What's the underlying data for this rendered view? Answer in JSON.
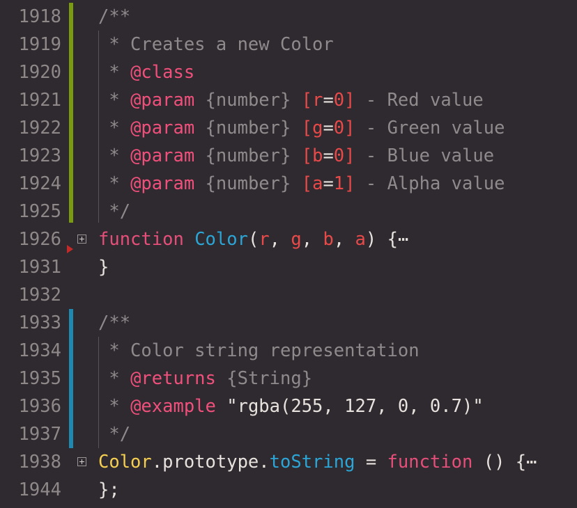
{
  "editor": {
    "colors": {
      "background": "#2f2a2f",
      "modified_bar_1": "#7a9a10",
      "modified_bar_2": "#1e88b0",
      "keyword": "#e54f7a",
      "function": "#2ba6d6",
      "class": "#f5cf52",
      "param": "#e84a4a",
      "error_marker": "#c42a2a"
    },
    "lines": [
      {
        "num": "1918",
        "tokens": [
          {
            "t": "/**",
            "c": "comment"
          }
        ]
      },
      {
        "num": "1919",
        "tokens": [
          {
            "t": " * Creates a new Color",
            "c": "comment"
          }
        ]
      },
      {
        "num": "1920",
        "tokens": [
          {
            "t": " * ",
            "c": "comment"
          },
          {
            "t": "@class",
            "c": "tag"
          }
        ]
      },
      {
        "num": "1921",
        "tokens": [
          {
            "t": " * ",
            "c": "comment"
          },
          {
            "t": "@param",
            "c": "tag"
          },
          {
            "t": " {number} ",
            "c": "type"
          },
          {
            "t": "[",
            "c": "param"
          },
          {
            "t": "r",
            "c": "param"
          },
          {
            "t": "=",
            "c": "plain"
          },
          {
            "t": "0",
            "c": "param"
          },
          {
            "t": "]",
            "c": "param"
          },
          {
            "t": " - Red value",
            "c": "comment"
          }
        ]
      },
      {
        "num": "1922",
        "tokens": [
          {
            "t": " * ",
            "c": "comment"
          },
          {
            "t": "@param",
            "c": "tag"
          },
          {
            "t": " {number} ",
            "c": "type"
          },
          {
            "t": "[",
            "c": "param"
          },
          {
            "t": "g",
            "c": "param"
          },
          {
            "t": "=",
            "c": "plain"
          },
          {
            "t": "0",
            "c": "param"
          },
          {
            "t": "]",
            "c": "param"
          },
          {
            "t": " - Green value",
            "c": "comment"
          }
        ]
      },
      {
        "num": "1923",
        "tokens": [
          {
            "t": " * ",
            "c": "comment"
          },
          {
            "t": "@param",
            "c": "tag"
          },
          {
            "t": " {number} ",
            "c": "type"
          },
          {
            "t": "[",
            "c": "param"
          },
          {
            "t": "b",
            "c": "param"
          },
          {
            "t": "=",
            "c": "plain"
          },
          {
            "t": "0",
            "c": "param"
          },
          {
            "t": "]",
            "c": "param"
          },
          {
            "t": " - Blue value",
            "c": "comment"
          }
        ]
      },
      {
        "num": "1924",
        "tokens": [
          {
            "t": " * ",
            "c": "comment"
          },
          {
            "t": "@param",
            "c": "tag"
          },
          {
            "t": " {number} ",
            "c": "type"
          },
          {
            "t": "[",
            "c": "param"
          },
          {
            "t": "a",
            "c": "param"
          },
          {
            "t": "=",
            "c": "plain"
          },
          {
            "t": "1",
            "c": "param"
          },
          {
            "t": "]",
            "c": "param"
          },
          {
            "t": " - Alpha value",
            "c": "comment"
          }
        ]
      },
      {
        "num": "1925",
        "tokens": [
          {
            "t": " */",
            "c": "comment"
          }
        ]
      },
      {
        "num": "1926",
        "fold": true,
        "error": true,
        "tokens": [
          {
            "t": "function",
            "c": "keyword"
          },
          {
            "t": " ",
            "c": "plain"
          },
          {
            "t": "Color",
            "c": "func"
          },
          {
            "t": "(",
            "c": "plain"
          },
          {
            "t": "r",
            "c": "param"
          },
          {
            "t": ", ",
            "c": "plain"
          },
          {
            "t": "g",
            "c": "param"
          },
          {
            "t": ", ",
            "c": "plain"
          },
          {
            "t": "b",
            "c": "param"
          },
          {
            "t": ", ",
            "c": "plain"
          },
          {
            "t": "a",
            "c": "param"
          },
          {
            "t": ") {⋯",
            "c": "plain"
          }
        ]
      },
      {
        "num": "1931",
        "tokens": [
          {
            "t": "}",
            "c": "plain"
          }
        ]
      },
      {
        "num": "1932",
        "tokens": []
      },
      {
        "num": "1933",
        "tokens": [
          {
            "t": "/**",
            "c": "comment"
          }
        ]
      },
      {
        "num": "1934",
        "tokens": [
          {
            "t": " * Color string representation",
            "c": "comment"
          }
        ]
      },
      {
        "num": "1935",
        "tokens": [
          {
            "t": " * ",
            "c": "comment"
          },
          {
            "t": "@returns",
            "c": "tag"
          },
          {
            "t": " {String}",
            "c": "type"
          }
        ]
      },
      {
        "num": "1936",
        "tokens": [
          {
            "t": " * ",
            "c": "comment"
          },
          {
            "t": "@example",
            "c": "tag"
          },
          {
            "t": " \"rgba(255, 127, 0, 0.7)\"",
            "c": "str"
          }
        ]
      },
      {
        "num": "1937",
        "tokens": [
          {
            "t": " */",
            "c": "comment"
          }
        ]
      },
      {
        "num": "1938",
        "fold": true,
        "tokens": [
          {
            "t": "Color",
            "c": "class"
          },
          {
            "t": ".prototype.",
            "c": "plain"
          },
          {
            "t": "toString",
            "c": "func"
          },
          {
            "t": " = ",
            "c": "plain"
          },
          {
            "t": "function",
            "c": "keyword"
          },
          {
            "t": " () {⋯",
            "c": "plain"
          }
        ]
      },
      {
        "num": "1944",
        "tokens": [
          {
            "t": "};",
            "c": "plain"
          }
        ]
      }
    ]
  }
}
